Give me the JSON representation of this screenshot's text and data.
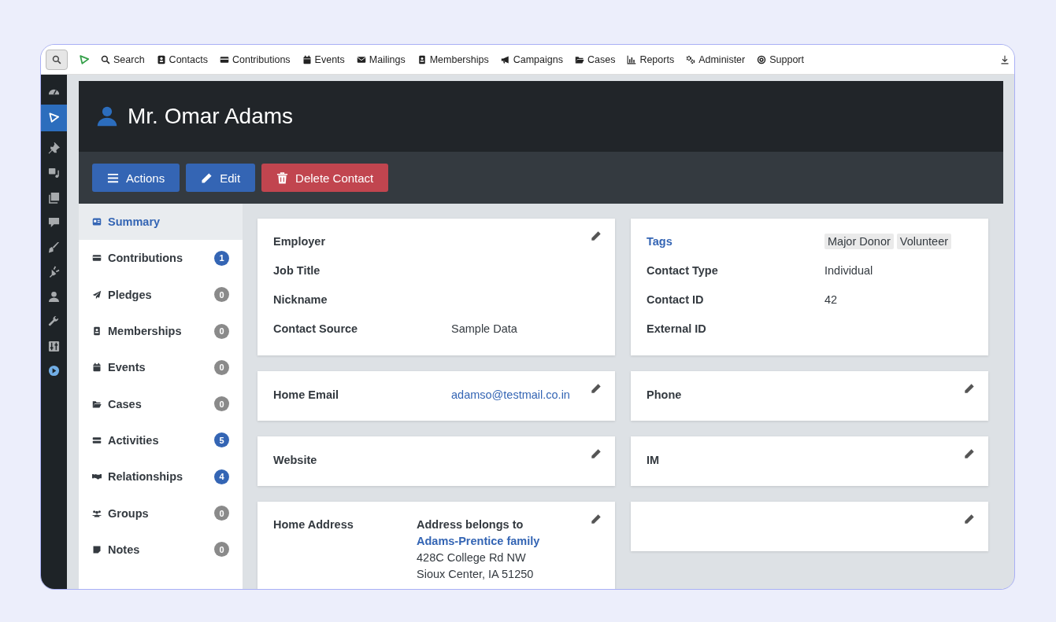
{
  "rail": [
    {
      "selected": false
    },
    {
      "selected": true
    },
    {
      "selected": false
    },
    {
      "selected": false
    },
    {
      "selected": false
    },
    {
      "selected": false
    },
    {
      "selected": false
    },
    {
      "selected": false
    },
    {
      "selected": false
    },
    {
      "selected": false
    },
    {
      "selected": false
    },
    {
      "selected": false
    }
  ],
  "menu": [
    {
      "label": "Search"
    },
    {
      "label": "Contacts"
    },
    {
      "label": "Contributions"
    },
    {
      "label": "Events"
    },
    {
      "label": "Mailings"
    },
    {
      "label": "Memberships"
    },
    {
      "label": "Campaigns"
    },
    {
      "label": "Cases"
    },
    {
      "label": "Reports"
    },
    {
      "label": "Administer"
    },
    {
      "label": "Support"
    }
  ],
  "contact": {
    "name": "Mr. Omar Adams"
  },
  "actions": [
    {
      "label": "Actions",
      "kind": "primary"
    },
    {
      "label": "Edit",
      "kind": "primary"
    },
    {
      "label": "Delete Contact",
      "kind": "danger"
    }
  ],
  "tabs": [
    {
      "label": "Summary",
      "selected": true
    },
    {
      "label": "Contributions",
      "count": "1",
      "color": "#3465b4",
      "selected": false
    },
    {
      "label": "Pledges",
      "count": "0",
      "color": "#8a8a8a",
      "selected": false
    },
    {
      "label": "Memberships",
      "count": "0",
      "color": "#8a8a8a",
      "selected": false
    },
    {
      "label": "Events",
      "count": "0",
      "color": "#8a8a8a",
      "selected": false
    },
    {
      "label": "Cases",
      "count": "0",
      "color": "#8a8a8a",
      "selected": false
    },
    {
      "label": "Activities",
      "count": "5",
      "color": "#3465b4",
      "selected": false
    },
    {
      "label": "Relationships",
      "count": "4",
      "color": "#3465b4",
      "selected": false
    },
    {
      "label": "Groups",
      "count": "0",
      "color": "#8a8a8a",
      "selected": false
    },
    {
      "label": "Notes",
      "count": "0",
      "color": "#8a8a8a",
      "selected": false
    }
  ],
  "cards": [
    {
      "editable": true,
      "fields": [
        {
          "label": "Employer",
          "kind": "plain"
        },
        {
          "label": "Job Title",
          "kind": "plain"
        },
        {
          "label": "Nickname",
          "kind": "plain"
        },
        {
          "label": "Contact Source",
          "kind": "plain",
          "value": "Sample Data"
        }
      ]
    },
    {
      "editable": false,
      "fields": [
        {
          "label": "Tags",
          "kind": "tags",
          "tags": [
            "Major Donor",
            "Volunteer"
          ]
        },
        {
          "label": "Contact Type",
          "kind": "plain",
          "value": "Individual"
        },
        {
          "label": "Contact ID",
          "kind": "plain",
          "value": "42"
        },
        {
          "label": "External ID",
          "kind": "plain"
        }
      ]
    },
    {
      "editable": true,
      "fields": [
        {
          "label": "Home Email",
          "kind": "link",
          "value": "adamso@testmail.co.in"
        }
      ]
    },
    {
      "editable": true,
      "fields": [
        {
          "label": "Phone",
          "kind": "plain"
        }
      ]
    },
    {
      "editable": true,
      "fields": [
        {
          "label": "Website",
          "kind": "plain"
        }
      ]
    },
    {
      "editable": true,
      "fields": [
        {
          "label": "IM",
          "kind": "plain"
        }
      ]
    },
    {
      "editable": true,
      "fields": [
        {
          "label": "Home Address",
          "kind": "address",
          "note": "Address belongs to",
          "link": "Adams-Prentice family",
          "lines": [
            "428C College Rd NW",
            "Sioux Center, IA 51250"
          ]
        }
      ]
    },
    {
      "editable": true
    }
  ]
}
